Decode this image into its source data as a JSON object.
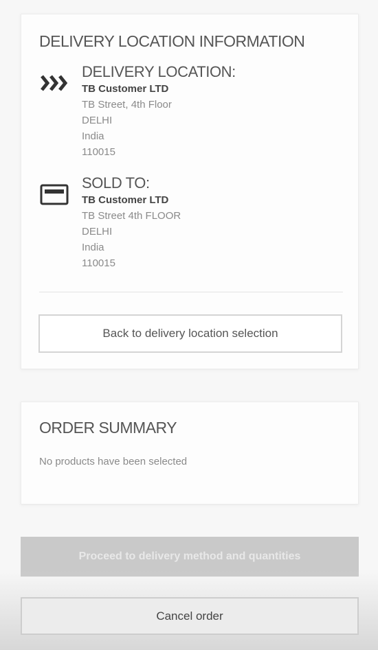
{
  "delivery_info": {
    "title": "DELIVERY LOCATION INFORMATION",
    "delivery_location": {
      "icon": "chevrons-right-icon",
      "heading": "DELIVERY LOCATION:",
      "name": "TB Customer LTD",
      "lines": [
        "TB Street, 4th Floor",
        "DELHI",
        "India",
        "110015"
      ]
    },
    "sold_to": {
      "icon": "credit-card-icon",
      "heading": "SOLD TO:",
      "name": "TB Customer LTD",
      "lines": [
        "TB Street 4th FLOOR",
        "DELHI",
        "India",
        "110015"
      ]
    },
    "back_button_label": "Back to delivery location selection"
  },
  "order_summary": {
    "title": "ORDER SUMMARY",
    "empty_message": "No products have been selected"
  },
  "actions": {
    "proceed_label": "Proceed to delivery method and quantities",
    "cancel_label": "Cancel order"
  },
  "colors": {
    "page_background": "#f7f7f7",
    "disabled_button": "#c9c9c9",
    "heading_text": "#555555",
    "muted_text": "#8a8a8a"
  }
}
